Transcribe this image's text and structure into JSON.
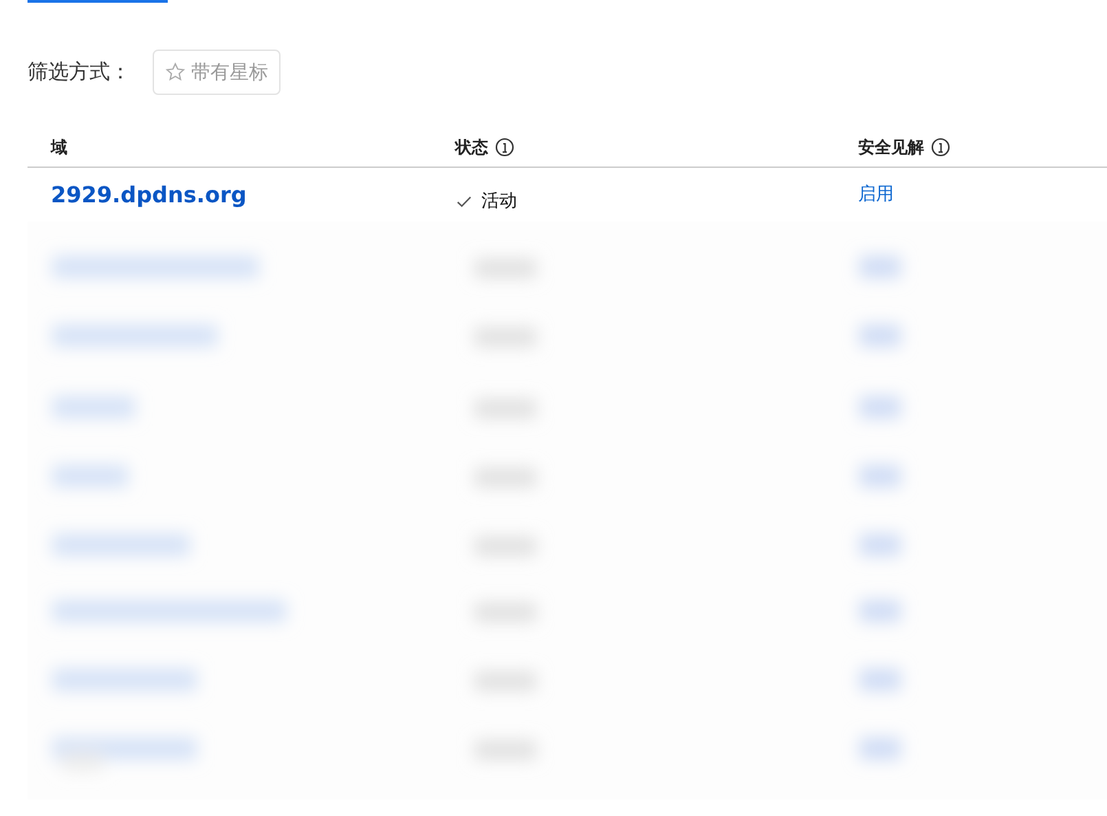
{
  "filter": {
    "label": "筛选方式：",
    "button": {
      "label": "带有星标",
      "selected": false
    }
  },
  "table": {
    "columns": [
      {
        "label": "域",
        "info": false
      },
      {
        "label": "状态",
        "info": true
      },
      {
        "label": "安全见解",
        "info": true
      }
    ],
    "rows": [
      {
        "domain": "2929.dpdns.org",
        "status": "活动",
        "active": true,
        "insight": "启用"
      }
    ]
  }
}
